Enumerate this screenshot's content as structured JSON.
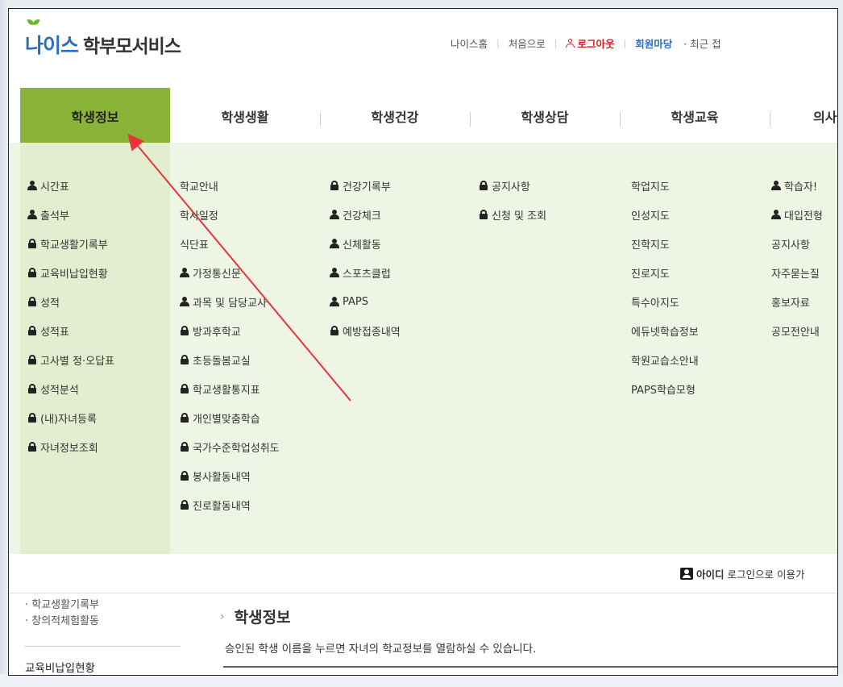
{
  "logo": {
    "brand": "나이스",
    "service": "학부모서비스"
  },
  "topnav": {
    "home": "나이스홈",
    "first": "처음으로",
    "logout": "로그아웃",
    "member": "회원마당",
    "recent": "· 최근 접"
  },
  "menu": [
    {
      "label": "학생정보",
      "active": true
    },
    {
      "label": "학생생활"
    },
    {
      "label": "학생건강"
    },
    {
      "label": "학생상담"
    },
    {
      "label": "학생교육"
    },
    {
      "label": "의사"
    }
  ],
  "dropdown": {
    "col1": [
      {
        "icon": "user-icon",
        "label": "시간표"
      },
      {
        "icon": "user-icon",
        "label": "출석부"
      },
      {
        "icon": "lock-icon",
        "label": "학교생활기록부"
      },
      {
        "icon": "lock-icon",
        "label": "교육비납입현황"
      },
      {
        "icon": "lock-icon",
        "label": "성적"
      },
      {
        "icon": "lock-icon",
        "label": "성적표"
      },
      {
        "icon": "lock-icon",
        "label": "고사별 정·오답표"
      },
      {
        "icon": "lock-icon",
        "label": "성적분석"
      },
      {
        "icon": "lock-icon",
        "label": "(내)자녀등록"
      },
      {
        "icon": "lock-icon",
        "label": "자녀정보조회"
      }
    ],
    "col2": [
      {
        "icon": "",
        "label": "학교안내"
      },
      {
        "icon": "",
        "label": "학사일정"
      },
      {
        "icon": "",
        "label": "식단표"
      },
      {
        "icon": "user-icon",
        "label": "가정통신문"
      },
      {
        "icon": "user-icon",
        "label": "과목 및 담당교사"
      },
      {
        "icon": "lock-icon",
        "label": "방과후학교"
      },
      {
        "icon": "lock-icon",
        "label": "초등돌봄교실"
      },
      {
        "icon": "lock-icon",
        "label": "학교생활통지표"
      },
      {
        "icon": "lock-icon",
        "label": "개인별맞춤학습"
      },
      {
        "icon": "lock-icon",
        "label": "국가수준학업성취도"
      },
      {
        "icon": "lock-icon",
        "label": "봉사활동내역"
      },
      {
        "icon": "lock-icon",
        "label": "진로활동내역"
      }
    ],
    "col3": [
      {
        "icon": "lock-icon",
        "label": "건강기록부"
      },
      {
        "icon": "user-icon",
        "label": "건강체크"
      },
      {
        "icon": "user-icon",
        "label": "신체활동"
      },
      {
        "icon": "user-icon",
        "label": "스포츠클럽"
      },
      {
        "icon": "user-icon",
        "label": "PAPS"
      },
      {
        "icon": "lock-icon",
        "label": "예방접종내역"
      }
    ],
    "col4": [
      {
        "icon": "lock-icon",
        "label": "공지사항"
      },
      {
        "icon": "lock-icon",
        "label": "신청 및 조회"
      }
    ],
    "col5": [
      {
        "icon": "",
        "label": "학업지도"
      },
      {
        "icon": "",
        "label": "인성지도"
      },
      {
        "icon": "",
        "label": "진학지도"
      },
      {
        "icon": "",
        "label": "진로지도"
      },
      {
        "icon": "",
        "label": "특수아지도"
      },
      {
        "icon": "",
        "label": "에듀넷학습정보"
      },
      {
        "icon": "",
        "label": "학원교습소안내"
      },
      {
        "icon": "",
        "label": "PAPS학습모형"
      }
    ],
    "col6": [
      {
        "icon": "user-icon",
        "label": "학습자!"
      },
      {
        "icon": "user-icon",
        "label": "대입전형"
      },
      {
        "icon": "",
        "label": "공지사항"
      },
      {
        "icon": "",
        "label": "자주묻는질"
      },
      {
        "icon": "",
        "label": "홍보자료"
      },
      {
        "icon": "",
        "label": "공모전안내"
      }
    ]
  },
  "login": {
    "id": "아이디",
    "msg": "로그인으로 이용가"
  },
  "sidebar": {
    "links": [
      "· 학교생활기록부",
      "· 창의적체험활동"
    ],
    "bottom": "교육비납입현황"
  },
  "content": {
    "title": "학생정보",
    "desc": "승인된 학생 이름을 누르면 자녀의 학교정보를 열람하실 수 있습니다."
  },
  "colors": {
    "active_tab": "#8ab437",
    "dropdown_bg": "#eff5e4",
    "brand_blue": "#2a6ebd",
    "logout_red": "#d42020",
    "annotation_arrow": "#e8343a"
  }
}
